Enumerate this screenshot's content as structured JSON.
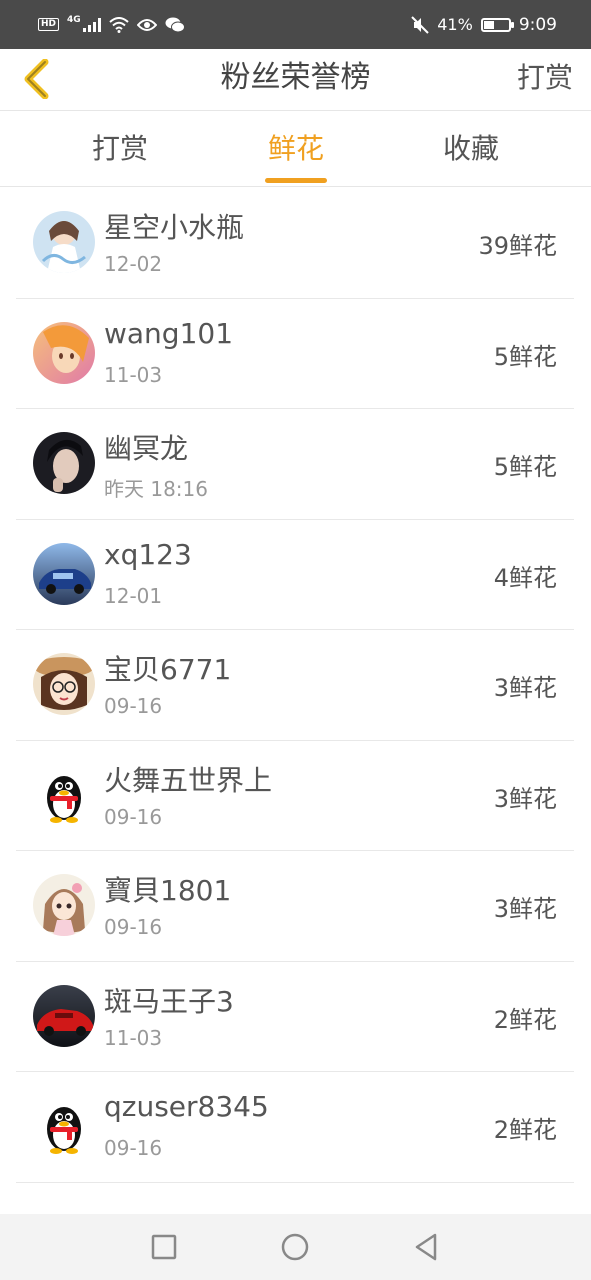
{
  "status_bar": {
    "hd": "HD",
    "network": "4G",
    "battery_text": "41%",
    "battery_level": 0.41,
    "time": "9:09"
  },
  "nav": {
    "title": "粉丝荣誉榜",
    "action": "打赏",
    "back_icon": "chevron-left-icon"
  },
  "tabs": [
    {
      "label": "打赏",
      "active": false
    },
    {
      "label": "鲜花",
      "active": true
    },
    {
      "label": "收藏",
      "active": false
    }
  ],
  "accent_color": "#f0a020",
  "list": [
    {
      "name": "星空小水瓶",
      "date": "12-02",
      "count": "39鲜花",
      "avatar": "anime-girl-avatar"
    },
    {
      "name": "wang101",
      "date": "11-03",
      "count": "5鲜花",
      "avatar": "anime-face-avatar"
    },
    {
      "name": "幽冥龙",
      "date": "昨天 18:16",
      "count": "5鲜花",
      "avatar": "portrait-avatar"
    },
    {
      "name": "xq123",
      "date": "12-01",
      "count": "4鲜花",
      "avatar": "car-avatar"
    },
    {
      "name": "宝贝6771",
      "date": "09-16",
      "count": "3鲜花",
      "avatar": "cartoon-girl-avatar"
    },
    {
      "name": "火舞五世界上",
      "date": "09-16",
      "count": "3鲜花",
      "avatar": "qq-penguin-avatar"
    },
    {
      "name": "寶貝1801",
      "date": "09-16",
      "count": "3鲜花",
      "avatar": "doll-avatar"
    },
    {
      "name": "斑马王子3",
      "date": "11-03",
      "count": "2鲜花",
      "avatar": "red-car-avatar"
    },
    {
      "name": "qzuser8345",
      "date": "09-16",
      "count": "2鲜花",
      "avatar": "qq-penguin-avatar"
    }
  ],
  "system_nav": {
    "recent_icon": "square-icon",
    "home_icon": "circle-icon",
    "back_icon": "triangle-back-icon"
  }
}
